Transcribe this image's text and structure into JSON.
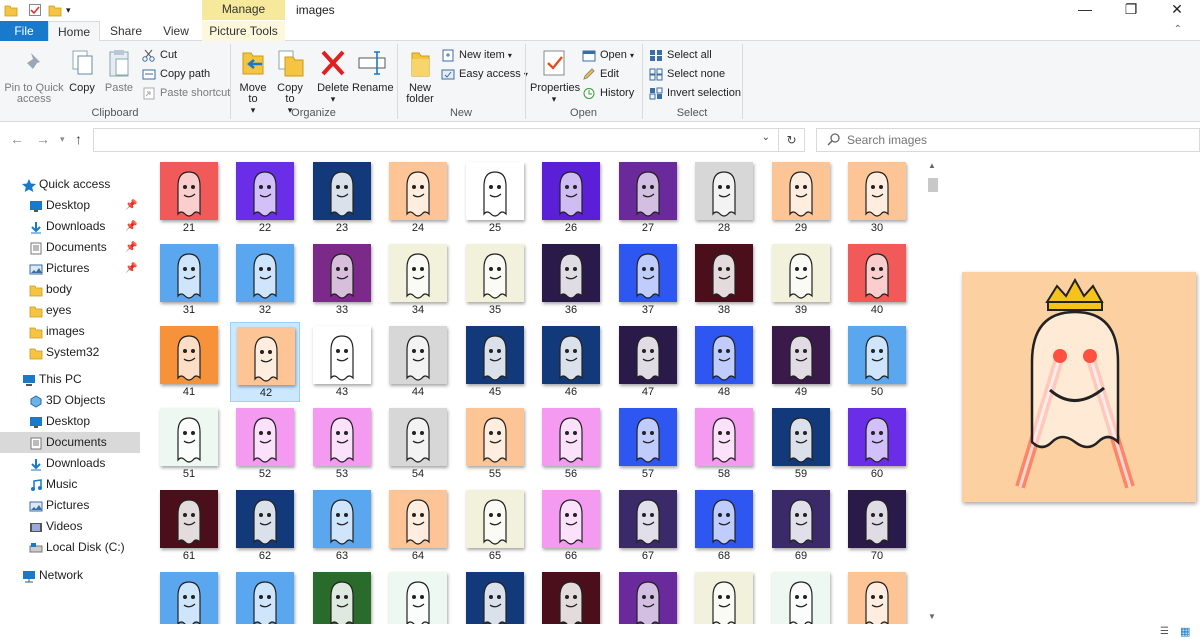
{
  "window": {
    "title": "images",
    "contextual_tab": "Manage",
    "minimize": "—",
    "maximize": "❐",
    "close": "✕"
  },
  "tabs": {
    "file": "File",
    "home": "Home",
    "share": "Share",
    "view": "View",
    "picture_tools": "Picture Tools"
  },
  "ribbon": {
    "clipboard": {
      "label": "Clipboard",
      "pin": "Pin to Quick access",
      "copy": "Copy",
      "paste": "Paste",
      "cut": "Cut",
      "copy_path": "Copy path",
      "paste_shortcut": "Paste shortcut"
    },
    "organize": {
      "label": "Organize",
      "move_to": "Move to",
      "copy_to": "Copy to",
      "delete": "Delete",
      "rename": "Rename"
    },
    "new": {
      "label": "New",
      "new_folder": "New folder",
      "new_item": "New item",
      "easy_access": "Easy access"
    },
    "open": {
      "label": "Open",
      "properties": "Properties",
      "open": "Open",
      "edit": "Edit",
      "history": "History"
    },
    "select": {
      "label": "Select",
      "select_all": "Select all",
      "select_none": "Select none",
      "invert": "Invert selection"
    }
  },
  "address": {
    "path": "",
    "search_placeholder": "Search images"
  },
  "nav": {
    "quick_access": "Quick access",
    "qa_items": [
      {
        "label": "Desktop",
        "pinned": true
      },
      {
        "label": "Downloads",
        "pinned": true
      },
      {
        "label": "Documents",
        "pinned": true
      },
      {
        "label": "Pictures",
        "pinned": true
      },
      {
        "label": "body",
        "pinned": false
      },
      {
        "label": "eyes",
        "pinned": false
      },
      {
        "label": "images",
        "pinned": false
      },
      {
        "label": "System32",
        "pinned": false
      }
    ],
    "this_pc": "This PC",
    "pc_items": [
      {
        "label": "3D Objects"
      },
      {
        "label": "Desktop"
      },
      {
        "label": "Documents",
        "selected": true
      },
      {
        "label": "Downloads"
      },
      {
        "label": "Music"
      },
      {
        "label": "Pictures"
      },
      {
        "label": "Videos"
      },
      {
        "label": "Local Disk (C:)"
      }
    ],
    "network": "Network"
  },
  "files": {
    "selected": "42",
    "items": [
      {
        "name": "21",
        "bg": "#f25a5a"
      },
      {
        "name": "22",
        "bg": "#6a2ee8"
      },
      {
        "name": "23",
        "bg": "#123a7a"
      },
      {
        "name": "24",
        "bg": "#fdc596"
      },
      {
        "name": "25",
        "bg": "#ffffff"
      },
      {
        "name": "26",
        "bg": "#5a1fd6"
      },
      {
        "name": "27",
        "bg": "#6a2a9c"
      },
      {
        "name": "28",
        "bg": "#d7d7d7"
      },
      {
        "name": "29",
        "bg": "#fdc596"
      },
      {
        "name": "30",
        "bg": "#fdc596"
      },
      {
        "name": "31",
        "bg": "#5aa7f0"
      },
      {
        "name": "32",
        "bg": "#5aa7f0"
      },
      {
        "name": "33",
        "bg": "#7b2a8a"
      },
      {
        "name": "34",
        "bg": "#f1f1dc"
      },
      {
        "name": "35",
        "bg": "#f1f1dc"
      },
      {
        "name": "36",
        "bg": "#2a1a4a"
      },
      {
        "name": "37",
        "bg": "#2e56f0"
      },
      {
        "name": "38",
        "bg": "#4a0f1a"
      },
      {
        "name": "39",
        "bg": "#f1f1dc"
      },
      {
        "name": "40",
        "bg": "#f25a5a"
      },
      {
        "name": "41",
        "bg": "#f5923a"
      },
      {
        "name": "42",
        "bg": "#fdc596"
      },
      {
        "name": "43",
        "bg": "#ffffff"
      },
      {
        "name": "44",
        "bg": "#d7d7d7"
      },
      {
        "name": "45",
        "bg": "#123a7a"
      },
      {
        "name": "46",
        "bg": "#123a7a"
      },
      {
        "name": "47",
        "bg": "#2a1a4a"
      },
      {
        "name": "48",
        "bg": "#2e56f0"
      },
      {
        "name": "49",
        "bg": "#3a1a4a"
      },
      {
        "name": "50",
        "bg": "#5aa7f0"
      },
      {
        "name": "51",
        "bg": "#eef8f2"
      },
      {
        "name": "52",
        "bg": "#f49af0"
      },
      {
        "name": "53",
        "bg": "#f49af0"
      },
      {
        "name": "54",
        "bg": "#d7d7d7"
      },
      {
        "name": "55",
        "bg": "#fdc596"
      },
      {
        "name": "56",
        "bg": "#f49af0"
      },
      {
        "name": "57",
        "bg": "#2e56f0"
      },
      {
        "name": "58",
        "bg": "#f49af0"
      },
      {
        "name": "59",
        "bg": "#123a7a"
      },
      {
        "name": "60",
        "bg": "#6a2ee8"
      },
      {
        "name": "61",
        "bg": "#4a0f1a"
      },
      {
        "name": "62",
        "bg": "#123a7a"
      },
      {
        "name": "63",
        "bg": "#5aa7f0"
      },
      {
        "name": "64",
        "bg": "#fdc596"
      },
      {
        "name": "65",
        "bg": "#f1f1dc"
      },
      {
        "name": "66",
        "bg": "#f49af0"
      },
      {
        "name": "67",
        "bg": "#3a2a6a"
      },
      {
        "name": "68",
        "bg": "#2e56f0"
      },
      {
        "name": "69",
        "bg": "#3a2a6a"
      },
      {
        "name": "70",
        "bg": "#2a1a4a"
      },
      {
        "name": "",
        "bg": "#5aa7f0"
      },
      {
        "name": "",
        "bg": "#5aa7f0"
      },
      {
        "name": "",
        "bg": "#2a6a2a"
      },
      {
        "name": "",
        "bg": "#eef8f2"
      },
      {
        "name": "",
        "bg": "#123a7a"
      },
      {
        "name": "",
        "bg": "#4a0f1a"
      },
      {
        "name": "",
        "bg": "#6a2a9c"
      },
      {
        "name": "",
        "bg": "#f1f1dc"
      },
      {
        "name": "",
        "bg": "#eef8f2"
      },
      {
        "name": "",
        "bg": "#fdc596"
      }
    ]
  },
  "preview": {
    "bg": "#fdd0a2"
  }
}
